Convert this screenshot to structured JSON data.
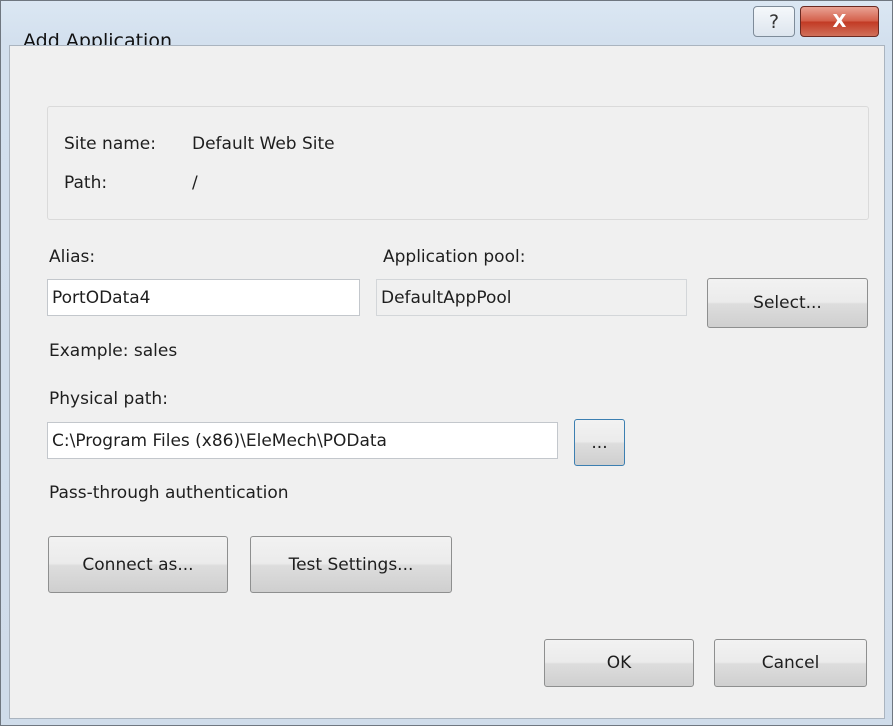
{
  "window": {
    "title": "Add Application",
    "help_glyph": "?",
    "close_glyph": "X"
  },
  "site_info": {
    "site_name_label": "Site name:",
    "site_name_value": "Default Web Site",
    "path_label": "Path:",
    "path_value": "/"
  },
  "alias": {
    "label": "Alias:",
    "value": "PortOData4",
    "example": "Example: sales"
  },
  "app_pool": {
    "label": "Application pool:",
    "value": "DefaultAppPool",
    "select_label": "Select..."
  },
  "physical_path": {
    "label": "Physical path:",
    "value": "C:\\Program Files (x86)\\EleMech\\POData",
    "browse_label": "..."
  },
  "auth": {
    "label": "Pass-through authentication",
    "connect_as_label": "Connect as...",
    "test_settings_label": "Test Settings..."
  },
  "footer": {
    "ok_label": "OK",
    "cancel_label": "Cancel"
  }
}
